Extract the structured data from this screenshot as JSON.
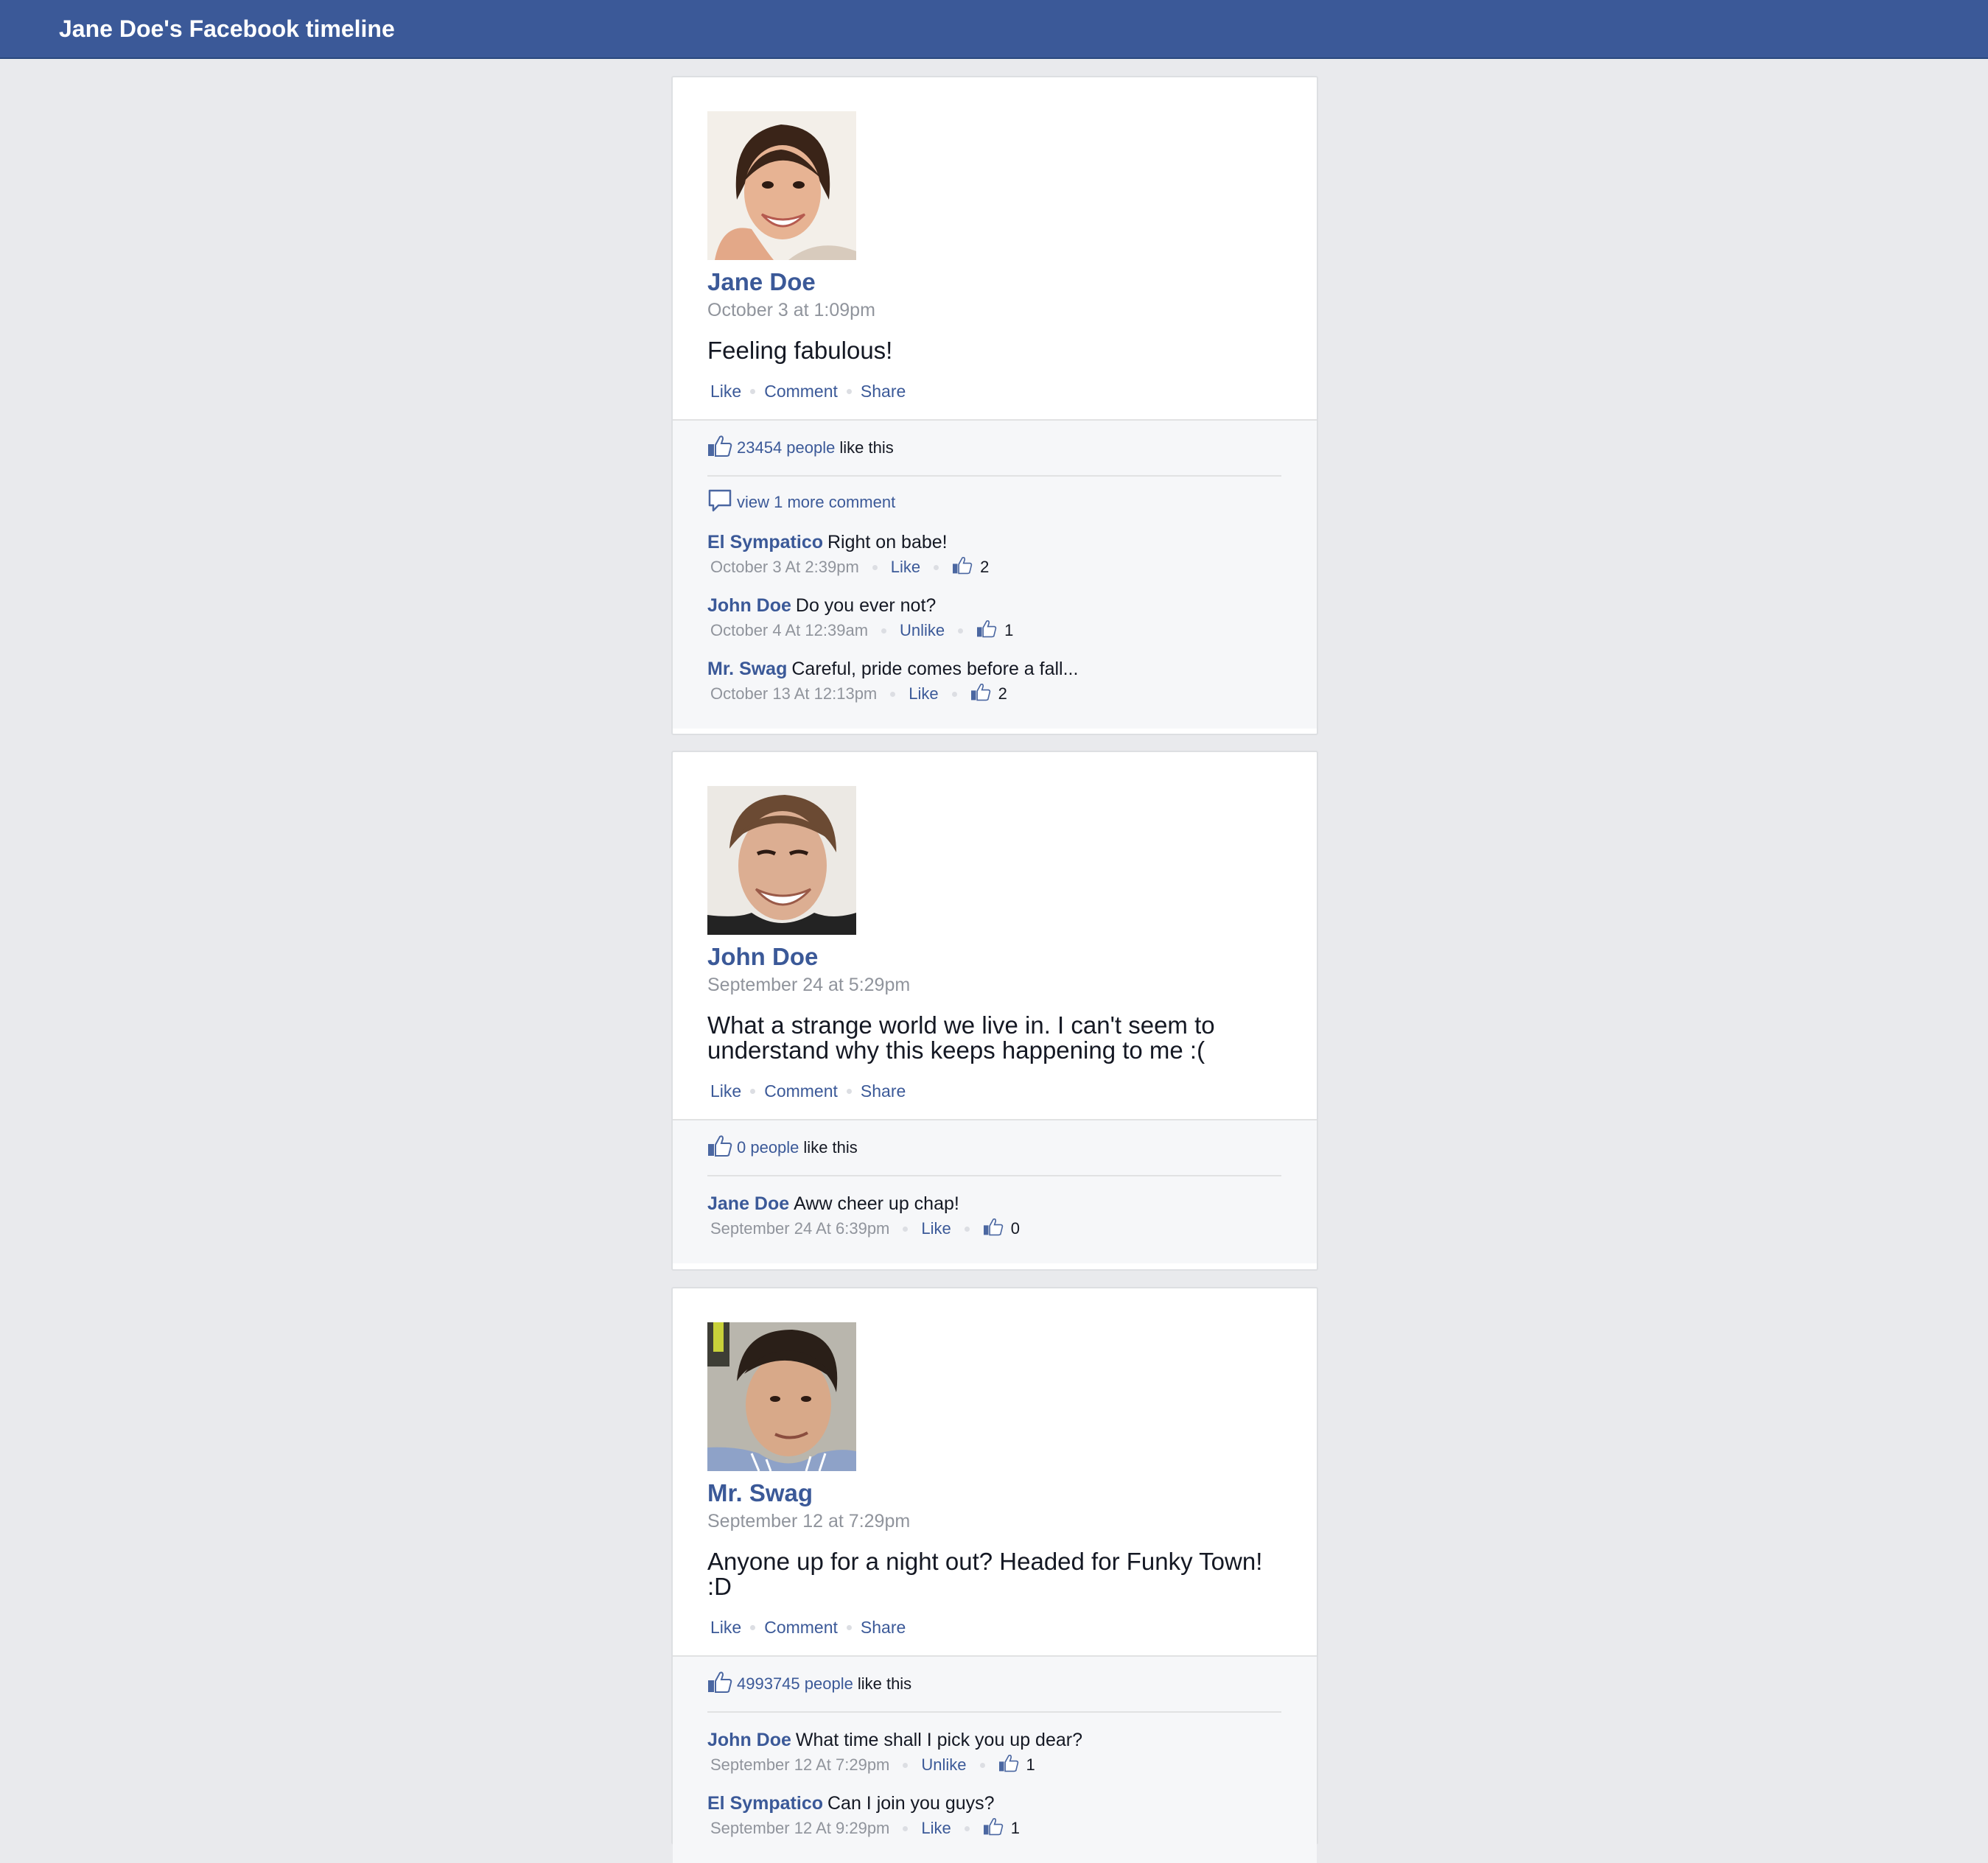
{
  "header": {
    "title": "Jane Doe's Facebook timeline"
  },
  "actions": {
    "like": "Like",
    "comment": "Comment",
    "share": "Share"
  },
  "colors": {
    "brand": "#3b5998",
    "background": "#e9eaed",
    "meta": "#90949c"
  },
  "posts": [
    {
      "author": "Jane Doe",
      "timestamp": "October 3 at 1:09pm",
      "message": "Feeling fabulous!",
      "likes_count": "23454 people",
      "likes_suffix": "like this",
      "more_comments": "view 1 more comment",
      "comments": [
        {
          "author": "El Sympatico",
          "text": "Right on babe!",
          "time": "October 3 At 2:39pm",
          "action": "Like",
          "likes": "2"
        },
        {
          "author": "John Doe",
          "text": "Do you ever not?",
          "time": "October 4 At 12:39am",
          "action": "Unlike",
          "likes": "1"
        },
        {
          "author": "Mr. Swag",
          "text": "Careful, pride comes before a fall...",
          "time": "October 13 At 12:13pm",
          "action": "Like",
          "likes": "2"
        }
      ]
    },
    {
      "author": "John Doe",
      "timestamp": "September 24 at 5:29pm",
      "message": "What a strange world we live in. I can't seem to understand why this keeps happening to me :(",
      "likes_count": "0 people",
      "likes_suffix": "like this",
      "comments": [
        {
          "author": "Jane Doe",
          "text": "Aww cheer up chap!",
          "time": "September 24 At 6:39pm",
          "action": "Like",
          "likes": "0"
        }
      ]
    },
    {
      "author": "Mr. Swag",
      "timestamp": "September 12 at 7:29pm",
      "message": "Anyone up for a night out? Headed for Funky Town! :D",
      "likes_count": "4993745 people",
      "likes_suffix": "like this",
      "comments": [
        {
          "author": "John Doe",
          "text": "What time shall I pick you up dear?",
          "time": "September 12 At 7:29pm",
          "action": "Unlike",
          "likes": "1"
        },
        {
          "author": "El Sympatico",
          "text": "Can I join you guys?",
          "time": "September 12 At 9:29pm",
          "action": "Like",
          "likes": "1"
        }
      ]
    }
  ]
}
